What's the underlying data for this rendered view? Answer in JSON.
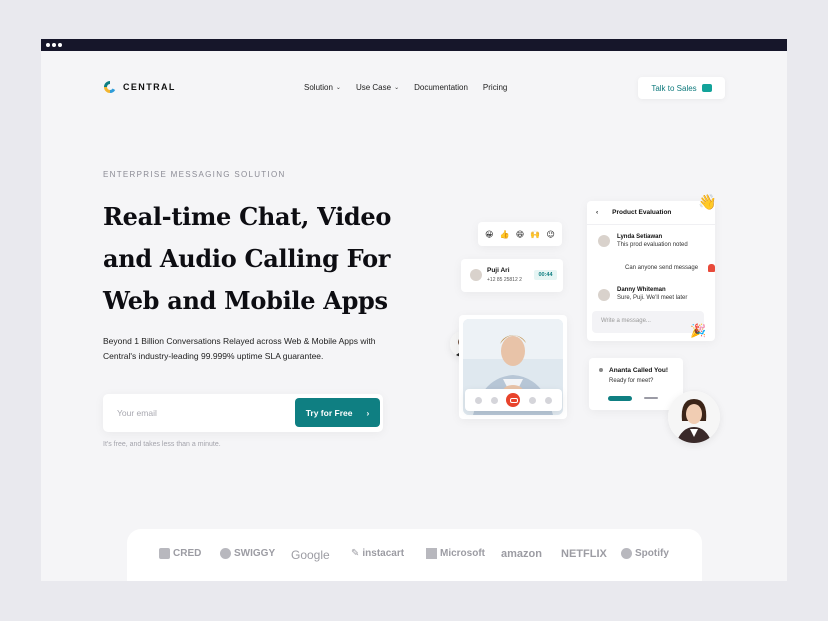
{
  "brand": {
    "name": "CENTRAL",
    "logo_colors": [
      "#0f7f82",
      "#f2b530",
      "#2f9cd8"
    ]
  },
  "nav": {
    "items": [
      {
        "label": "Solution",
        "has_dropdown": true
      },
      {
        "label": "Use Case",
        "has_dropdown": true
      },
      {
        "label": "Documentation",
        "has_dropdown": false
      },
      {
        "label": "Pricing",
        "has_dropdown": false
      }
    ],
    "cta": "Talk to Sales",
    "cta_icon": "chat-icon"
  },
  "hero": {
    "eyebrow": "ENTERPRISE MESSAGING SOLUTION",
    "headline": [
      "Real-time Chat, Video",
      "and Audio Calling For",
      "Web and Mobile Apps"
    ],
    "subtext": "Beyond 1 Billion Conversations Relayed across Web & Mobile Apps with Central's industry-leading 99.999% uptime SLA guarantee.",
    "email_placeholder": "Your email",
    "email_value": "",
    "try_button": "Try for Free",
    "fineprint": "It's free, and takes less than a minute."
  },
  "illustration": {
    "emojis": [
      "😀",
      "👍",
      "😄",
      "🙌",
      "😉"
    ],
    "contact": {
      "name": "Puji Ari",
      "phone": "+12 85 25812 2",
      "timer": "00:44"
    },
    "chat_panel": {
      "title": "Product Evaluation",
      "messages": [
        {
          "author": "Lynda Setiawan",
          "text": "This prod evaluation noted"
        },
        {
          "author": "",
          "text": "Can anyone send message"
        },
        {
          "author": "Danny Whiteman",
          "text": "Sure, Puji. We'll meet later"
        }
      ],
      "input_placeholder": "Write a message..."
    },
    "notification": {
      "title": "Ananta Called You!",
      "text": "Ready for meet?"
    },
    "wave_emoji": "👋",
    "party_emoji": "🎉"
  },
  "logos": [
    "CRED",
    "SWIGGY",
    "Google",
    "instacart",
    "Microsoft",
    "amazon",
    "NETFLIX",
    "Spotify"
  ],
  "colors": {
    "accent": "#0f7f82",
    "end_call": "#e8432c",
    "background": "#f5f5f7",
    "titlebar": "#16162a"
  }
}
